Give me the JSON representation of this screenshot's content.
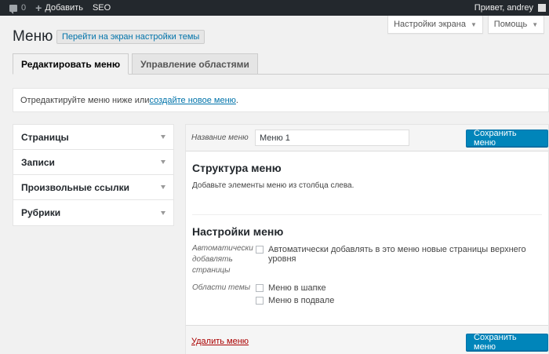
{
  "adminbar": {
    "comments_count": "0",
    "add_label": "Добавить",
    "seo_label": "SEO",
    "greeting": "Привет, andrey"
  },
  "screen_options": {
    "label": "Настройки экрана",
    "help_label": "Помощь"
  },
  "page": {
    "title": "Меню",
    "theme_link": "Перейти на экран настройки темы"
  },
  "tabs": [
    {
      "label": "Редактировать меню",
      "active": true
    },
    {
      "label": "Управление областями",
      "active": false
    }
  ],
  "notice": {
    "text_before": "Отредактируйте меню ниже или ",
    "link": "создайте новое меню",
    "text_after": "."
  },
  "accordion": [
    {
      "label": "Страницы"
    },
    {
      "label": "Записи"
    },
    {
      "label": "Произвольные ссылки"
    },
    {
      "label": "Рубрики"
    }
  ],
  "editor": {
    "name_label": "Название меню",
    "name_value": "Меню 1",
    "save_label": "Сохранить меню",
    "structure_title": "Структура меню",
    "structure_desc": "Добавьте элементы меню из столбца слева.",
    "settings_title": "Настройки меню",
    "auto_add_label": "Автоматически добавлять страницы",
    "auto_add_option": "Автоматически добавлять в это меню новые страницы верхнего уровня",
    "locations_label": "Области темы",
    "location_header": "Меню в шапке",
    "location_footer": "Меню в подвале",
    "delete_label": "Удалить меню"
  }
}
